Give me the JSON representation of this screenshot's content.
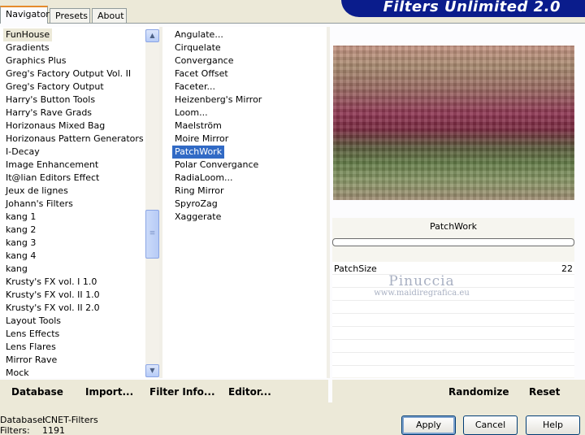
{
  "tabs": [
    {
      "label": "Navigator",
      "active": true
    },
    {
      "label": "Presets",
      "active": false
    },
    {
      "label": "About",
      "active": false
    }
  ],
  "banner_title": "Filters Unlimited 2.0",
  "categories": [
    {
      "label": "FunHouse",
      "selected": true
    },
    {
      "label": "Gradients"
    },
    {
      "label": "Graphics Plus"
    },
    {
      "label": "Greg's Factory Output Vol. II"
    },
    {
      "label": "Greg's Factory Output"
    },
    {
      "label": "Harry's Button Tools"
    },
    {
      "label": "Harry's Rave Grads"
    },
    {
      "label": "Horizonaus Mixed Bag"
    },
    {
      "label": "Horizonaus Pattern Generators"
    },
    {
      "label": "I-Decay"
    },
    {
      "label": "Image Enhancement"
    },
    {
      "label": "It@lian Editors Effect"
    },
    {
      "label": "Jeux de lignes"
    },
    {
      "label": "Johann's Filters"
    },
    {
      "label": "kang 1"
    },
    {
      "label": "kang 2"
    },
    {
      "label": "kang 3"
    },
    {
      "label": "kang 4"
    },
    {
      "label": "kang"
    },
    {
      "label": "Krusty's FX vol. I 1.0"
    },
    {
      "label": "Krusty's FX vol. II 1.0"
    },
    {
      "label": "Krusty's FX vol. II 2.0"
    },
    {
      "label": "Layout Tools"
    },
    {
      "label": "Lens Effects"
    },
    {
      "label": "Lens Flares"
    },
    {
      "label": "Mirror Rave"
    },
    {
      "label": "Mock"
    }
  ],
  "filters": [
    {
      "label": "Angulate..."
    },
    {
      "label": "Cirquelate"
    },
    {
      "label": "Convergance"
    },
    {
      "label": "Facet Offset"
    },
    {
      "label": "Faceter..."
    },
    {
      "label": "Heizenberg's Mirror"
    },
    {
      "label": "Loom..."
    },
    {
      "label": "Maelström"
    },
    {
      "label": "Moire Mirror"
    },
    {
      "label": "PatchWork",
      "selected": true
    },
    {
      "label": "Polar Convergance"
    },
    {
      "label": "RadiaLoom..."
    },
    {
      "label": "Ring Mirror"
    },
    {
      "label": "SpyroZag"
    },
    {
      "label": "Xaggerate"
    }
  ],
  "selected_filter_name": "PatchWork",
  "parameters": [
    {
      "name": "PatchSize",
      "value": "22"
    }
  ],
  "watermark": {
    "line1": "Pinuccia",
    "line2": "www.maidiregrafica.eu"
  },
  "toolbar": {
    "database": "Database",
    "import": "Import...",
    "filter_info": "Filter Info...",
    "editor": "Editor...",
    "randomize": "Randomize",
    "reset": "Reset"
  },
  "status": {
    "database_label": "Database:",
    "database_value": "ICNET-Filters",
    "filters_label": "Filters:",
    "filters_value": "1191"
  },
  "buttons": {
    "apply": "Apply",
    "cancel": "Cancel",
    "help": "Help"
  },
  "colors": {
    "selection_blue": "#316ac5",
    "banner_blue": "#0a1c8c"
  }
}
